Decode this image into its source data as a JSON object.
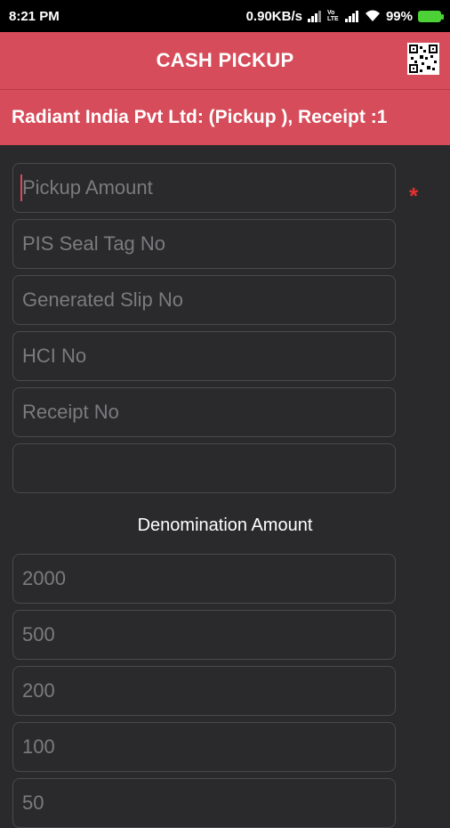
{
  "status_bar": {
    "time": "8:21 PM",
    "net_speed": "0.90KB/s",
    "volte": "Vo LTE",
    "battery": "99%"
  },
  "appbar": {
    "title": "CASH PICKUP",
    "qr_icon": "qr-code-icon"
  },
  "subheader": {
    "text": "Radiant India Pvt Ltd: (Pickup ), Receipt :1"
  },
  "form": {
    "pickup_amount": {
      "placeholder": "Pickup Amount",
      "value": ""
    },
    "required_mark": "*",
    "pis_seal_tag": {
      "placeholder": "PIS Seal Tag No",
      "value": ""
    },
    "generated_slip": {
      "placeholder": "Generated Slip No",
      "value": ""
    },
    "hci_no": {
      "placeholder": "HCI No",
      "value": ""
    },
    "receipt_no": {
      "placeholder": "Receipt No",
      "value": ""
    },
    "extra_field": {
      "placeholder": "",
      "value": ""
    }
  },
  "denominations": {
    "label": "Denomination Amount",
    "items": [
      {
        "placeholder": "2000",
        "value": ""
      },
      {
        "placeholder": "500",
        "value": ""
      },
      {
        "placeholder": "200",
        "value": ""
      },
      {
        "placeholder": "100",
        "value": ""
      },
      {
        "placeholder": "50",
        "value": ""
      }
    ]
  },
  "colors": {
    "accent": "#d64c5a",
    "background": "#2a2a2c",
    "required": "#e53030"
  }
}
